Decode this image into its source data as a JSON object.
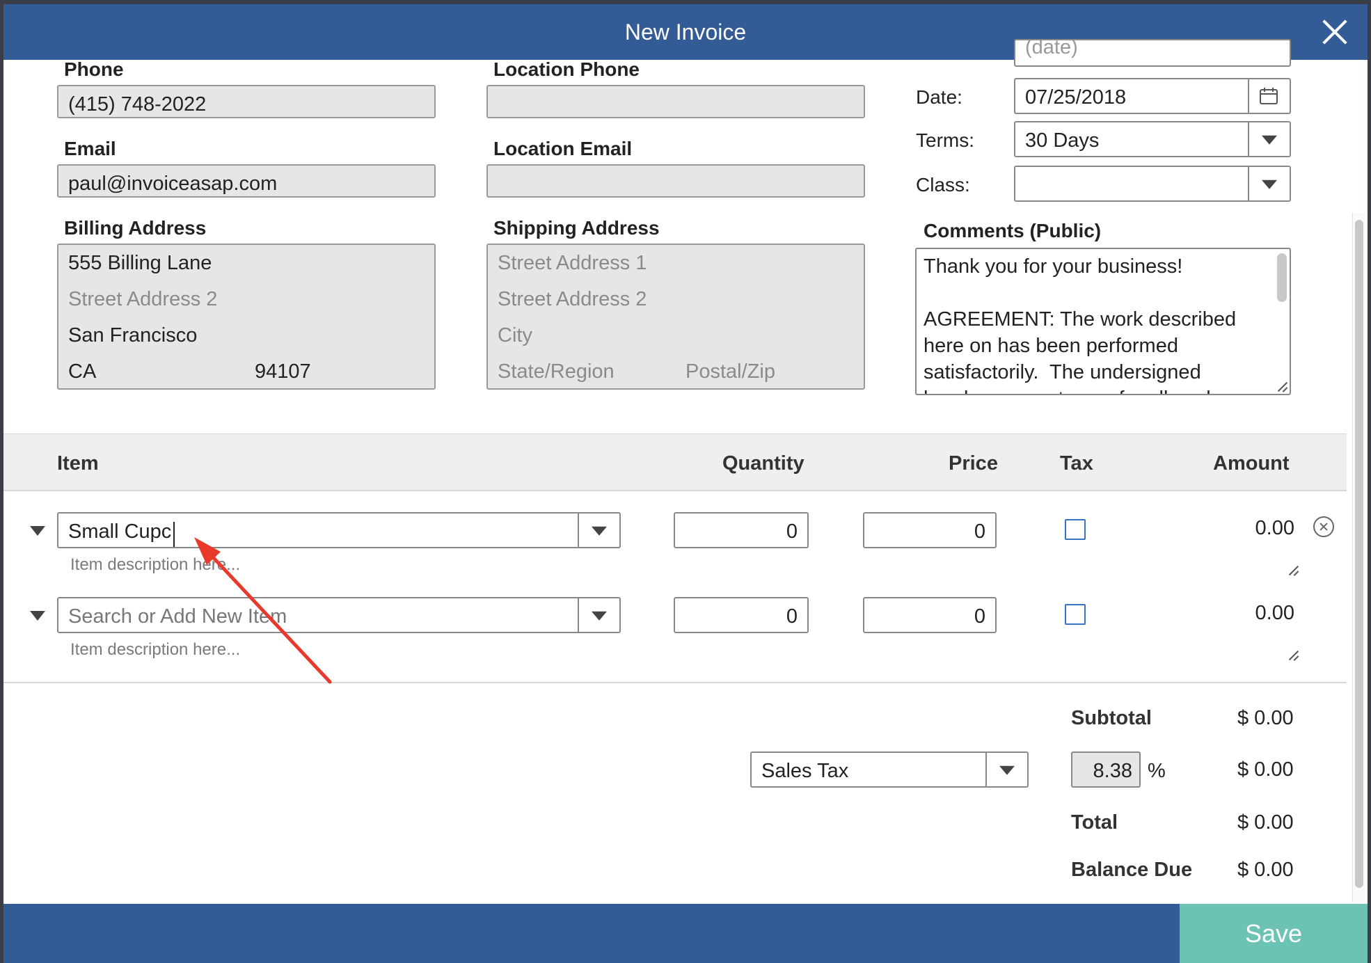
{
  "dialog": {
    "title": "New Invoice",
    "save_label": "Save"
  },
  "contact": {
    "phone_label": "Phone",
    "phone": "(415) 748-2022",
    "email_label": "Email",
    "email": "paul@invoiceasap.com",
    "location_phone_label": "Location Phone",
    "location_phone": "",
    "location_email_label": "Location Email",
    "location_email": ""
  },
  "billing": {
    "label": "Billing Address",
    "street1": "555 Billing Lane",
    "street2_placeholder": "Street Address 2",
    "city": "San Francisco",
    "state": "CA",
    "zip": "94107"
  },
  "shipping": {
    "label": "Shipping Address",
    "street1_placeholder": "Street Address 1",
    "street2_placeholder": "Street Address 2",
    "city_placeholder": "City",
    "state_placeholder": "State/Region",
    "zip_placeholder": "Postal/Zip"
  },
  "meta": {
    "po_placeholder": "(date)",
    "date_label": "Date:",
    "date": "07/25/2018",
    "terms_label": "Terms:",
    "terms": "30 Days",
    "class_label": "Class:",
    "class": ""
  },
  "comments": {
    "label": "Comments (Public)",
    "text": "Thank you for your business!\n\nAGREEMENT: The work described here on has been performed satisfactorily.  The undersigned hereby agrees to pay for all work"
  },
  "table": {
    "headers": {
      "item": "Item",
      "quantity": "Quantity",
      "price": "Price",
      "tax": "Tax",
      "amount": "Amount"
    },
    "rows": [
      {
        "item": "Small Cupc",
        "item_placeholder": "",
        "description_placeholder": "Item description here...",
        "quantity": "0",
        "price": "0",
        "amount": "0.00"
      },
      {
        "item": "",
        "item_placeholder": "Search or Add New Item",
        "description_placeholder": "Item description here...",
        "quantity": "0",
        "price": "0",
        "amount": "0.00"
      }
    ]
  },
  "totals": {
    "subtotal_label": "Subtotal",
    "subtotal": "$ 0.00",
    "tax_select": "Sales Tax",
    "tax_rate": "8.38",
    "percent": "%",
    "tax_amount": "$ 0.00",
    "total_label": "Total",
    "total": "$ 0.00",
    "balance_label": "Balance Due",
    "balance": "$ 0.00"
  },
  "colors": {
    "header": "#335b95",
    "save": "#6cc3b3",
    "annotation_arrow": "#e8392b"
  }
}
